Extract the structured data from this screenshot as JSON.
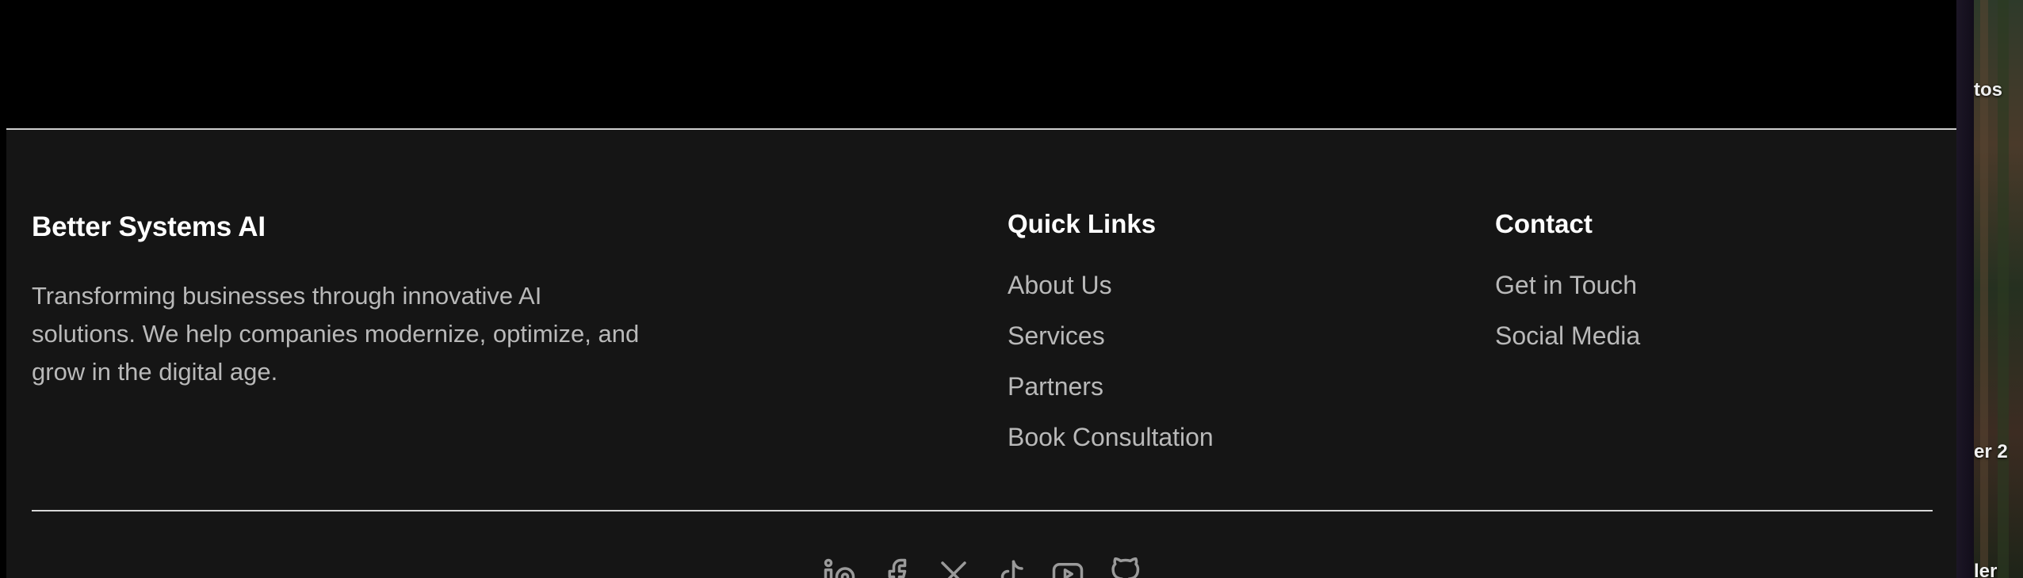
{
  "footer": {
    "brand": {
      "title": "Better Systems AI",
      "description": "Transforming businesses through innovative AI solutions. We help companies modernize, optimize, and grow in the digital age."
    },
    "quick_links": {
      "title": "Quick Links",
      "items": [
        "About Us",
        "Services",
        "Partners",
        "Book Consultation"
      ]
    },
    "contact": {
      "title": "Contact",
      "items": [
        "Get in Touch",
        "Social Media"
      ]
    },
    "social_icons": [
      "linkedin-icon",
      "facebook-icon",
      "x-icon",
      "tiktok-icon",
      "youtube-icon",
      "github-icon"
    ]
  },
  "desktop": {
    "labels": [
      "tos",
      "er 2",
      "ler"
    ]
  },
  "colors": {
    "footer_bg": "#151515",
    "heading": "#ffffff",
    "body_text": "#b9b9b9"
  }
}
